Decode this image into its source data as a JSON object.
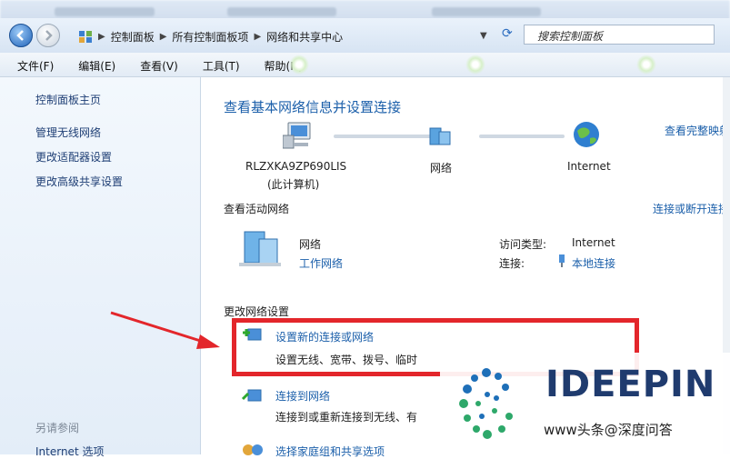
{
  "breadcrumb": {
    "items": [
      "控制面板",
      "所有控制面板项",
      "网络和共享中心"
    ]
  },
  "search": {
    "text": "搜索控制面板"
  },
  "menu": [
    "文件(F)",
    "编辑(E)",
    "查看(V)",
    "工具(T)",
    "帮助(H)"
  ],
  "sidebar": {
    "home": "控制面板主页",
    "links": [
      "管理无线网络",
      "更改适配器设置",
      "更改高级共享设置"
    ],
    "see_also": "另请参阅",
    "internet_options": "Internet 选项"
  },
  "main": {
    "title": "查看基本网络信息并设置连接",
    "full_map": "查看完整映射",
    "computer_name": "RLZXKA9ZP690LIS",
    "this_computer": "(此计算机)",
    "network": "网络",
    "internet": "Internet",
    "active_networks_header": "查看活动网络",
    "connect_disconnect": "连接或断开连接",
    "active_network_name": "网络",
    "active_network_type": "工作网络",
    "access_type_label": "访问类型:",
    "access_type_value": "Internet",
    "connections_label": "连接:",
    "connections_value": "本地连接",
    "change_settings_header": "更改网络设置",
    "tasks": [
      {
        "title": "设置新的连接或网络",
        "desc": "设置无线、宽带、拨号、临时"
      },
      {
        "title": "连接到网络",
        "desc": "连接到或重新连接到无线、有"
      },
      {
        "title": "选择家庭组和共享选项",
        "desc": ""
      }
    ]
  },
  "watermark": {
    "logo_text": "IDEEPIN",
    "caption": "www头条@深度问答"
  },
  "colors": {
    "link": "#1b5faa",
    "highlight_box": "#e3262b",
    "arrow": "#e3262b"
  }
}
